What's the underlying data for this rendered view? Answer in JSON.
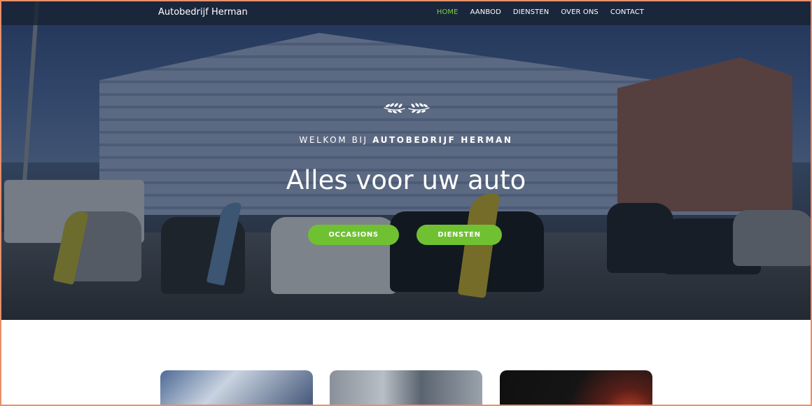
{
  "brand": "Autobedrijf Herman",
  "nav": {
    "items": [
      {
        "label": "HOME",
        "active": true
      },
      {
        "label": "AANBOD",
        "active": false
      },
      {
        "label": "DIENSTEN",
        "active": false
      },
      {
        "label": "OVER ONS",
        "active": false
      },
      {
        "label": "CONTACT",
        "active": false
      }
    ]
  },
  "hero": {
    "welcome_prefix": "WELKOM BIJ",
    "welcome_name": "AUTOBEDRIJF HERMAN",
    "headline": "Alles voor uw auto",
    "buttons": {
      "occasions": "OCCASIONS",
      "diensten": "DIENSTEN"
    }
  },
  "colors": {
    "accent": "#6fc132",
    "nav_active": "#7ed13f",
    "nav_bg": "#19233a",
    "frame_border": "#e8906a"
  },
  "icons": {
    "laurel": "laurel-wreath-icon"
  }
}
